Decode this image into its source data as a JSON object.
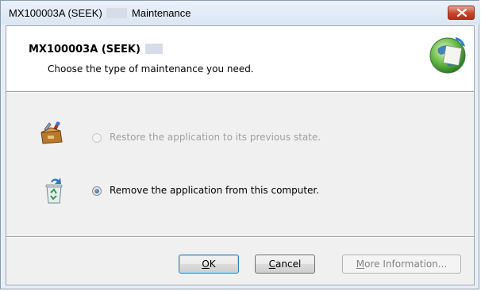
{
  "window": {
    "title_prefix": "MX100003A (SEEK)",
    "title_suffix": "Maintenance"
  },
  "header": {
    "title": "MX100003A (SEEK)",
    "subtitle": "Choose the type of maintenance you need."
  },
  "options": [
    {
      "label": "Restore the application to its previous state.",
      "selected": false,
      "enabled": false,
      "icon": "repair-toolbox-icon"
    },
    {
      "label": "Remove the application from this computer.",
      "selected": true,
      "enabled": true,
      "icon": "recycle-bin-icon"
    }
  ],
  "buttons": {
    "ok": {
      "mnemonic": "O",
      "rest": "K"
    },
    "cancel": {
      "mnemonic": "C",
      "rest": "ancel"
    },
    "more_info": {
      "mnemonic": "M",
      "rest": "ore Information..."
    }
  },
  "colors": {
    "close_button": "#c7462b",
    "title_bar": "#dbe6f4",
    "disabled_text": "#a0a0a0"
  }
}
